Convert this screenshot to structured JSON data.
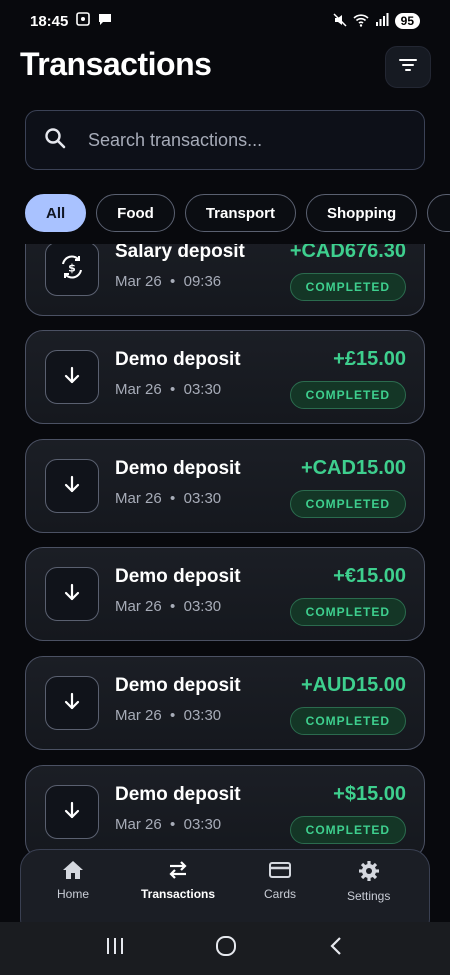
{
  "status_bar": {
    "time": "18:45",
    "battery": "95"
  },
  "page_title": "Transactions",
  "search": {
    "placeholder": "Search transactions..."
  },
  "filters": [
    {
      "label": "All",
      "active": true
    },
    {
      "label": "Food",
      "active": false
    },
    {
      "label": "Transport",
      "active": false
    },
    {
      "label": "Shopping",
      "active": false
    }
  ],
  "transactions": [
    {
      "title": "Salary deposit",
      "date": "Mar 26",
      "time": "09:36",
      "amount": "+CAD676.30",
      "status": "COMPLETED",
      "icon": "salary-icon"
    },
    {
      "title": "Demo deposit",
      "date": "Mar 26",
      "time": "03:30",
      "amount": "+£15.00",
      "status": "COMPLETED",
      "icon": "arrow-down-icon"
    },
    {
      "title": "Demo deposit",
      "date": "Mar 26",
      "time": "03:30",
      "amount": "+CAD15.00",
      "status": "COMPLETED",
      "icon": "arrow-down-icon"
    },
    {
      "title": "Demo deposit",
      "date": "Mar 26",
      "time": "03:30",
      "amount": "+€15.00",
      "status": "COMPLETED",
      "icon": "arrow-down-icon"
    },
    {
      "title": "Demo deposit",
      "date": "Mar 26",
      "time": "03:30",
      "amount": "+AUD15.00",
      "status": "COMPLETED",
      "icon": "arrow-down-icon"
    },
    {
      "title": "Demo deposit",
      "date": "Mar 26",
      "time": "03:30",
      "amount": "+$15.00",
      "status": "COMPLETED",
      "icon": "arrow-down-icon"
    }
  ],
  "nav": [
    {
      "label": "Home",
      "icon": "home-icon",
      "active": false
    },
    {
      "label": "Transactions",
      "icon": "swap-icon",
      "active": true
    },
    {
      "label": "Cards",
      "icon": "card-icon",
      "active": false
    },
    {
      "label": "Settings",
      "icon": "gear-icon",
      "active": false
    }
  ],
  "colors": {
    "accent": "#a9c2ff",
    "positive": "#3ecf8e",
    "background": "#08090d"
  }
}
